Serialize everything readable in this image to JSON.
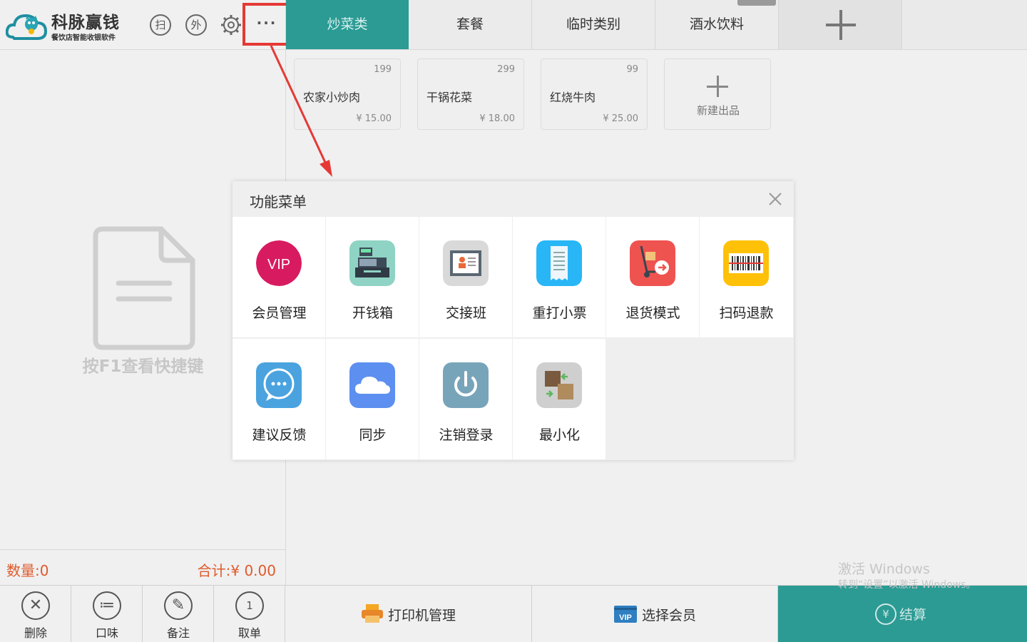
{
  "header": {
    "logo_title": "科脉赢钱",
    "logo_subtitle": "餐饮店智能收银软件",
    "scan_label": "扫",
    "takeout_label": "外",
    "more_label": "···"
  },
  "tabs": [
    {
      "label": "炒菜类",
      "active": true
    },
    {
      "label": "套餐",
      "active": false
    },
    {
      "label": "临时类别",
      "active": false
    },
    {
      "label": "酒水饮料",
      "active": false
    }
  ],
  "products": [
    {
      "count": "199",
      "name": "农家小炒肉",
      "price": "¥ 15.00"
    },
    {
      "count": "299",
      "name": "干锅花菜",
      "price": "¥ 18.00"
    },
    {
      "count": "99",
      "name": "红烧牛肉",
      "price": "¥ 25.00"
    }
  ],
  "new_product_label": "新建出品",
  "left": {
    "f1_hint": "按F1查看快捷键",
    "qty": "数量:0",
    "sum": "合计:¥ 0.00"
  },
  "left_buttons": [
    {
      "label": "删除",
      "icon": "close-icon"
    },
    {
      "label": "口味",
      "icon": "list-icon"
    },
    {
      "label": "备注",
      "icon": "pen-icon"
    },
    {
      "label": "取单",
      "icon": "number-one-icon"
    }
  ],
  "bottom": {
    "printer_label": "打印机管理",
    "member_label": "选择会员",
    "pay_label": "结算",
    "vip_badge": "VIP",
    "yen": "¥"
  },
  "watermark": {
    "line1": "激活 Windows",
    "line2": "转到“设置”以激活 Windows。"
  },
  "modal": {
    "title": "功能菜单",
    "items": [
      {
        "label": "会员管理",
        "icon": "vip-icon",
        "vip_text": "VIP",
        "color": "#d81b60"
      },
      {
        "label": "开钱箱",
        "icon": "cash-register-icon",
        "color": "#8fd3c4"
      },
      {
        "label": "交接班",
        "icon": "shift-card-icon",
        "color": "#d9d9d9"
      },
      {
        "label": "重打小票",
        "icon": "receipt-icon",
        "color": "#29b6f6"
      },
      {
        "label": "退货模式",
        "icon": "return-cart-icon",
        "color": "#ef5350"
      },
      {
        "label": "扫码退款",
        "icon": "barcode-icon",
        "color": "#ffc107"
      },
      {
        "label": "建议反馈",
        "icon": "chat-bubble-icon",
        "color": "#4aa3df"
      },
      {
        "label": "同步",
        "icon": "cloud-icon",
        "color": "#5c8ff0"
      },
      {
        "label": "注销登录",
        "icon": "power-icon",
        "color": "#78a4ba"
      },
      {
        "label": "最小化",
        "icon": "minimize-boxes-icon",
        "color": "#cfcfcf"
      }
    ]
  }
}
